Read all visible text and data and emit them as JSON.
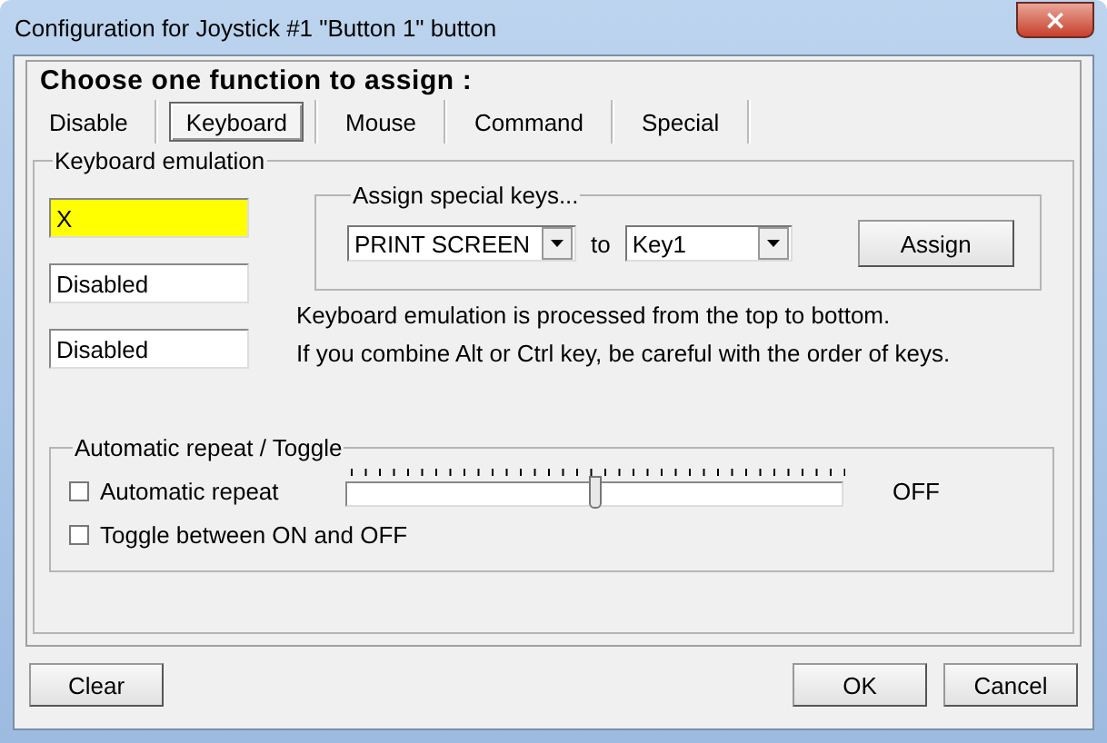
{
  "window": {
    "title": "Configuration for Joystick #1 \"Button 1\" button",
    "close": "×"
  },
  "heading": "Choose one function to assign :",
  "tabs": [
    {
      "label": "Disable",
      "selected": false
    },
    {
      "label": "Keyboard",
      "selected": true
    },
    {
      "label": "Mouse",
      "selected": false
    },
    {
      "label": "Command",
      "selected": false
    },
    {
      "label": "Special",
      "selected": false
    }
  ],
  "keyboard_emulation": {
    "title": "Keyboard emulation",
    "keys": [
      {
        "value": "X",
        "selected": true
      },
      {
        "value": "Disabled",
        "selected": false
      },
      {
        "value": "Disabled",
        "selected": false
      }
    ],
    "special": {
      "title": "Assign special keys...",
      "key": "PRINT SCREEN",
      "to": "to",
      "target": "Key1",
      "button": "Assign"
    },
    "notes": [
      "Keyboard emulation is processed from the top to bottom.",
      "If you combine Alt or Ctrl key, be careful with the order of keys."
    ]
  },
  "repeat": {
    "title": "Automatic repeat / Toggle",
    "options": [
      {
        "label": "Automatic repeat",
        "checked": false
      },
      {
        "label": "Toggle between ON and OFF",
        "checked": false
      }
    ],
    "slider": {
      "level": 0.49
    },
    "reading": "OFF"
  },
  "buttons": [
    "Clear",
    "OK",
    "Cancel"
  ]
}
